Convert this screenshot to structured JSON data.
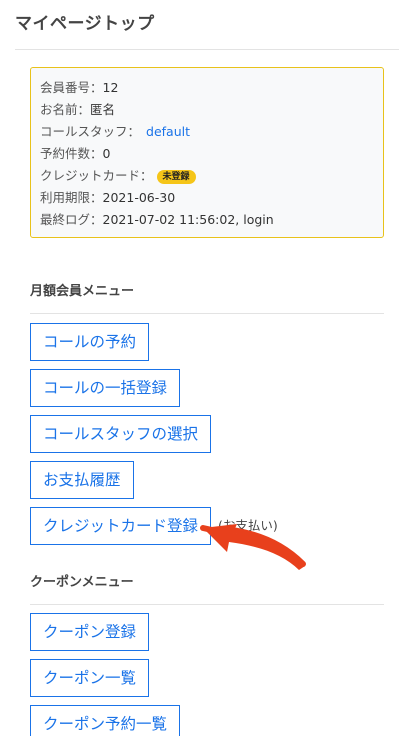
{
  "header": {
    "title": "マイページトップ"
  },
  "member_info": {
    "member_no_label": "会員番号：",
    "member_no": "12",
    "name_label": "お名前：",
    "name": "匿名",
    "staff_label": "コールスタッフ：",
    "staff_link": "default",
    "reservations_label": "予約件数：",
    "reservations": "0",
    "card_label": "クレジットカード：",
    "card_status": "未登録",
    "expiry_label": "利用期限：",
    "expiry": "2021-06-30",
    "last_log_label": "最終ログ：",
    "last_log": "2021-07-02 11:56:02, login"
  },
  "monthly_menu": {
    "title": "月額会員メニュー",
    "buttons": [
      "コールの予約",
      "コールの一括登録",
      "コールスタッフの選択",
      "お支払履歴",
      "クレジットカード登録"
    ],
    "card_note": "(お支払い)"
  },
  "coupon_menu": {
    "title": "クーポンメニュー",
    "buttons": [
      "クーポン登録",
      "クーポン一覧",
      "クーポン予約一覧"
    ]
  },
  "colors": {
    "accent": "#1a73e8",
    "badge": "#f5c518",
    "box_border": "#e8c21a",
    "arrow": "#e8401c"
  },
  "annotation": {
    "icon": "red-arrow-icon"
  }
}
